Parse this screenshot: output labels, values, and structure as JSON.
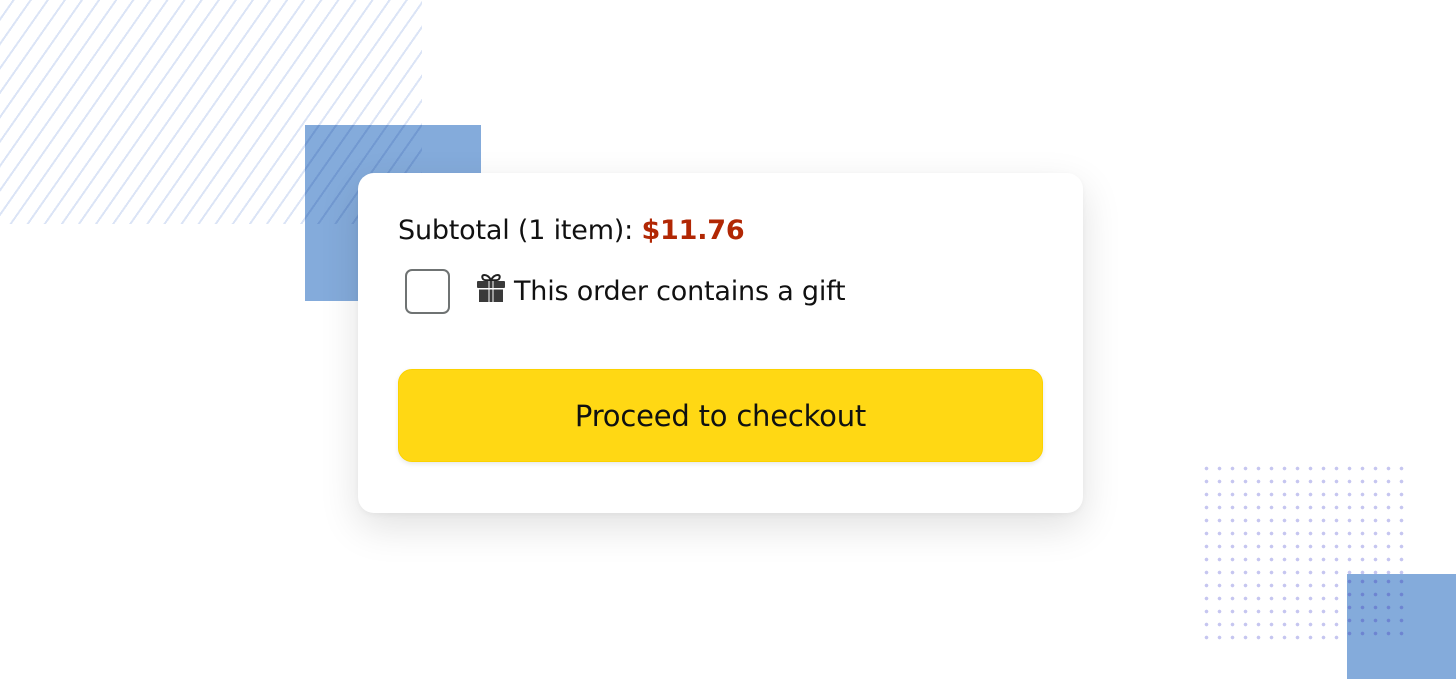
{
  "cart": {
    "subtotal_label": "Subtotal (1 item):",
    "subtotal_value": "$11.76",
    "price_color": "#b12704",
    "gift_label": "This order contains a gift",
    "gift_checked": false,
    "gift_icon": "gift-icon",
    "checkout_label": "Proceed to checkout",
    "button_color": "#ffd814"
  },
  "decor": {
    "accent_blue": "#84abdb",
    "dot_color": "#c6c6f0"
  }
}
